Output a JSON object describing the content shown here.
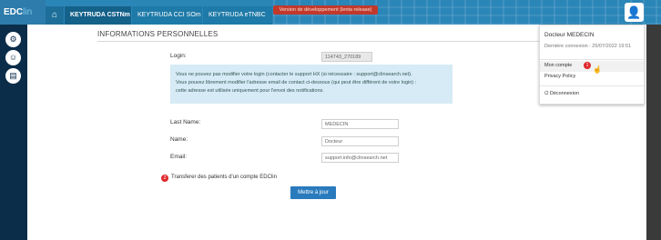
{
  "app": {
    "logo_main": "EDC",
    "logo_accent": "lin"
  },
  "tabs": [
    {
      "label": "KEYTRUDA CSTNm"
    },
    {
      "label": "KEYTRUDA CCI SOm"
    },
    {
      "label": "KEYTRUDA eTNBC"
    }
  ],
  "icons": {
    "home": "home-icon",
    "avatar": "user-avatar-icon",
    "sidebar": [
      "settings-icon",
      "users-icon",
      "document-icon"
    ]
  },
  "dev_banner": "Version de développement (lenta release)",
  "page": {
    "title": "INFORMATIONS PERSONNELLES",
    "login_label": "Login:",
    "login_value": "114743_270189",
    "info_text_1": "Vous ne pouvez pas modifier votre login (contacter le support HX (si nécessaire : support@clinsearch.net).",
    "info_text_2": "Vous pouvez librement modifier l'adresse email de contact ci-dessous (qui peut être différent de votre login) :",
    "info_text_3": "cette adresse est utilisée uniquement pour l'envoi des notifications.",
    "lastname_label": "Last Name:",
    "lastname_value": "MEDECIN",
    "name_label": "Name:",
    "name_value": "Docteur",
    "email_label": "Email:",
    "email_value": "support.info@clinsearch.net",
    "transfer_badge": "2",
    "transfer_link": "Transferer des patients d'un compte EDClin",
    "update_button": "Mettre à jour"
  },
  "dropdown": {
    "user_name": "Docteur MEDECIN",
    "last_connection": "Dernière connexion : 25/07/2022 19:51",
    "my_account": "Mon compte",
    "account_badge": "1",
    "privacy": "Privacy Policy",
    "logout": "Déconnexion"
  },
  "colors": {
    "topbar": "#2b86b8",
    "sidebar": "#0b2d49",
    "accent_button": "#2a7bbd",
    "badge_red": "#e0282a",
    "info_box": "#d6ebf5"
  }
}
